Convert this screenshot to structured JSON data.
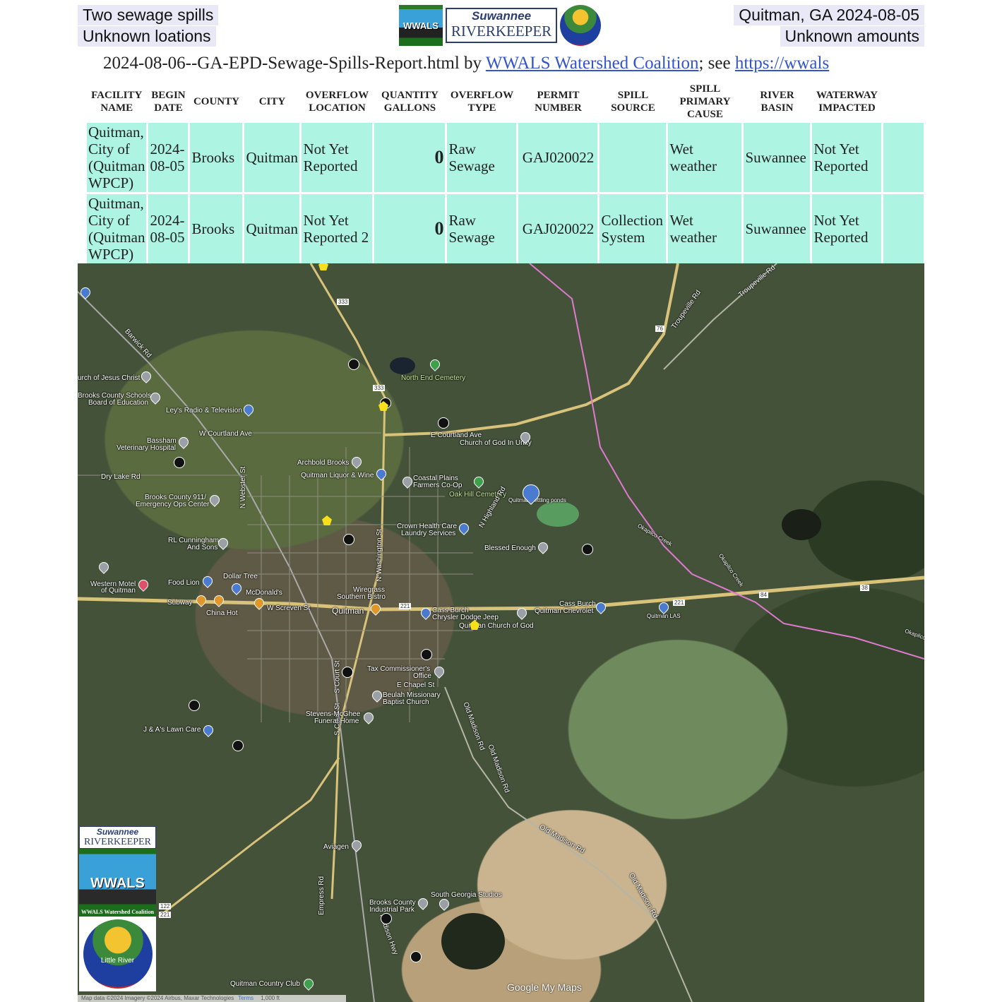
{
  "header": {
    "top_left": [
      "Two sewage spills",
      "Unknown loations"
    ],
    "top_right": [
      "Quitman, GA 2024-08-05",
      "Unknown amounts"
    ],
    "logos": {
      "wwals": "WWALS",
      "riverkeeper_line1": "Suwannee",
      "riverkeeper_line2": "RIVERKEEPER",
      "water_trail": "Little River"
    },
    "title_prefix": "2024-08-06--GA-EPD-Sewage-Spills-Report.html by ",
    "title_link1": "WWALS Watershed Coalition",
    "title_mid": "; see ",
    "title_link2": "https://wwals"
  },
  "table": {
    "headers": [
      "FACILITY NAME",
      "BEGIN DATE",
      "COUNTY",
      "CITY",
      "OVERFLOW LOCATION",
      "QUANTITY GALLONS",
      "OVERFLOW TYPE",
      "PERMIT NUMBER",
      "SPILL SOURCE",
      "SPILL PRIMARY CAUSE",
      "RIVER BASIN",
      "WATERWAY IMPACTED",
      ""
    ],
    "rows": [
      [
        "Quitman, City of (Quitman WPCP)",
        "2024-08-05",
        "Brooks",
        "Quitman",
        "Not Yet Reported",
        "0",
        "Raw Sewage",
        "GAJ020022",
        "",
        "Wet weather",
        "Suwannee",
        "Not Yet Reported",
        ""
      ],
      [
        "Quitman, City of (Quitman WPCP)",
        "2024-08-05",
        "Brooks",
        "Quitman",
        "Not Yet Reported 2",
        "0",
        "Raw Sewage",
        "GAJ020022",
        "Collection System",
        "Wet weather",
        "Suwannee",
        "Not Yet Reported",
        ""
      ]
    ]
  },
  "map": {
    "labels": {
      "barwick": "Barwick Rd",
      "church_jc": "urch of Jesus Christ",
      "schools": "Brooks County Schools",
      "board": "Board of Education",
      "leys": "Ley's Radio & Television",
      "w_courtland": "W Courtland Ave",
      "e_courtland": "E Courtland Ave",
      "bassham": "Bassham",
      "vet": "Veterinary Hospital",
      "dry_lake": "Dry Lake Rd",
      "archbold": "Archbold Brooks",
      "liquor": "Quitman Liquor & Wine",
      "north_end": "North End Cemetery",
      "church_unity": "Church of God In Unity",
      "coastal1": "Coastal Plains",
      "coastal2": "Farmers Co-Op",
      "oak_hill": "Oak Hill Cemetery",
      "ponds": "Quitman settling ponds",
      "crown1": "Crown Health Care",
      "crown2": "Laundry Services",
      "blessed": "Blessed Enough",
      "n_highland": "N Highland Rd",
      "brooks911_1": "Brooks County 911/",
      "brooks911_2": "Emergency Ops Center",
      "n_webster": "N Webster St",
      "n_washington": "N Washington St",
      "rl1": "RL Cunningham",
      "rl2": "And Sons",
      "motel1": "Western Motel",
      "motel2": "of Quitman",
      "food_lion": "Food Lion",
      "dollar_tree": "Dollar Tree",
      "mcdonalds": "McDonald's",
      "subway": "Subway",
      "china_hot": "China Hot",
      "w_screven": "W Screven St",
      "quitman": "Quitman",
      "wiregrass1": "Wiregrass",
      "wiregrass2": "Southern Bistro",
      "cass1": "Cass Burch",
      "cass1b": "Chrysler Dodge Jeep",
      "quitman_cog": "Quitman Church of God",
      "cass2": "Cass Burch",
      "cass2b": "Quitman Chevrolet",
      "quitman_las": "Quitman LAS",
      "troupeville": "Troupeville Rd",
      "okapilco1": "Okapilco Creek",
      "okapilco2": "Okapilco Creek",
      "okapilco3": "Okapilco Creek",
      "s_court": "S Court St",
      "tax1": "Tax Commissioner's",
      "tax2": "Office",
      "e_chapel": "E Chapel St",
      "beulah1": "Beulah Missionary",
      "beulah2": "Baptist Church",
      "stevens1": "Stevens-McGhee",
      "stevens2": "Funeral Home",
      "ja_lawn": "J & A's Lawn Care",
      "old_madison1": "Old Madison Rd",
      "old_madison2": "Old Madison Rd",
      "old_madison3": "Old Madison Rd",
      "old_madison4": "Old Madison Rd",
      "aviagen": "Aviagen",
      "sg_studios": "South Georgia Studios",
      "industrial1": "Brooks County",
      "industrial2": "Industrial Park",
      "madison_hwy": "Madison Hwy",
      "empress": "Empress Rd",
      "country_club": "Quitman Country Club",
      "hw_333": "333",
      "hw_76": "76",
      "hw_221": "221",
      "hw_84": "84",
      "hw_38": "38",
      "hw_122": "122"
    },
    "side_logos": {
      "rk1": "Suwannee",
      "rk2": "RIVERKEEPER",
      "wwals": "WWALS",
      "coalition": "WWALS Watershed Coalition",
      "water_trail": "Little River"
    },
    "attribution": "Map data ©2024 Imagery ©2024 Airbus, Maxar Technologies",
    "terms": "Terms",
    "scale": "1,000 ft",
    "branding": "Google My Maps"
  }
}
